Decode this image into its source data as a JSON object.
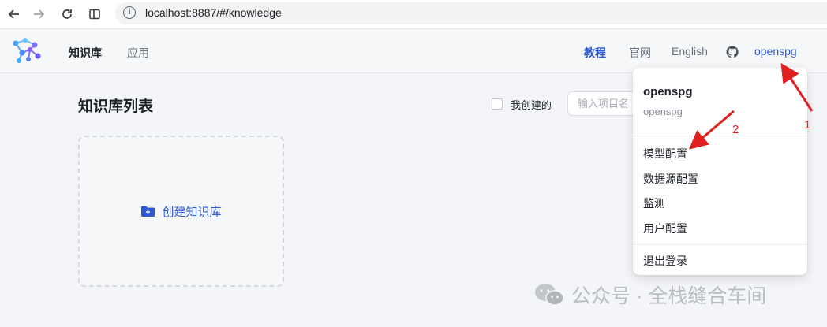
{
  "browser": {
    "url": "localhost:8887/#/knowledge",
    "back_icon": "arrow-left-icon",
    "forward_icon": "arrow-right-icon",
    "reload_icon": "reload-icon",
    "split_icon": "split-view-icon",
    "info_icon": "info-icon"
  },
  "header": {
    "logo": "openspg-logo",
    "nav": [
      {
        "label": "知识库",
        "active": true
      },
      {
        "label": "应用",
        "active": false
      }
    ],
    "links": {
      "tutorial": "教程",
      "official": "官网",
      "english": "English",
      "github_icon": "github-icon",
      "user": "openspg"
    }
  },
  "main": {
    "title": "知识库列表",
    "mine_label": "我创建的",
    "mine_checked": false,
    "search_placeholder": "输入项目名",
    "create_label": "创建知识库",
    "create_icon": "folder-plus-icon"
  },
  "dropdown": {
    "username": "openspg",
    "subname": "openspg",
    "items": [
      "模型配置",
      "数据源配置",
      "监测",
      "用户配置"
    ],
    "logout": "退出登录"
  },
  "annotations": {
    "label1": "1",
    "label2": "2",
    "color": "#e02020"
  },
  "watermark": {
    "text": "公众号 · 全栈缝合车间",
    "icon": "wechat-icon"
  },
  "colors": {
    "accent": "#2d5bd8",
    "text": "#1f2329",
    "muted": "#6b7280"
  }
}
